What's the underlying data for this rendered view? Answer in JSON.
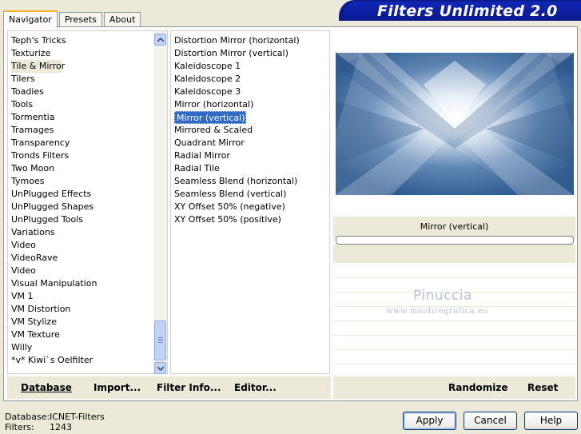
{
  "tabs": [
    "Navigator",
    "Presets",
    "About"
  ],
  "banner_title": "Filters Unlimited 2.0",
  "categories": [
    "Teph's Tricks",
    "Texturize",
    "Tile & Mirror",
    "Tilers",
    "Toadies",
    "Tools",
    "Tormentia",
    "Tramages",
    "Transparency",
    "Tronds Filters",
    "Two Moon",
    "Tymoes",
    "UnPlugged Effects",
    "UnPlugged Shapes",
    "UnPlugged Tools",
    "Variations",
    "Video",
    "VideoRave",
    "Video",
    "Visual Manipulation",
    "VM 1",
    "VM Distortion",
    "VM Stylize",
    "VM Texture",
    "Willy",
    "*v* Kiwi`s Oelfilter"
  ],
  "selected_category": "Tile & Mirror",
  "filters": [
    "Distortion Mirror (horizontal)",
    "Distortion Mirror (vertical)",
    "Kaleidoscope 1",
    "Kaleidoscope 2",
    "Kaleidoscope 3",
    "Mirror (horizontal)",
    "Mirror (vertical)",
    "Mirrored & Scaled",
    "Quadrant Mirror",
    "Radial Mirror",
    "Radial Tile",
    "Seamless Blend (horizontal)",
    "Seamless Blend (vertical)",
    "XY Offset 50% (negative)",
    "XY Offset 50% (positive)"
  ],
  "selected_filter": "Mirror (vertical)",
  "preview_filter_name": "Mirror (vertical)",
  "watermark": {
    "line1": "Pinuccia",
    "line2": "www.maidiregrafica.eu"
  },
  "toolbar_left": {
    "database": "Database",
    "import": "Import...",
    "filter_info": "Filter Info...",
    "editor": "Editor..."
  },
  "toolbar_right": {
    "randomize": "Randomize",
    "reset": "Reset"
  },
  "status": {
    "database_label": "Database:",
    "database_value": "ICNET-Filters",
    "filters_label": "Filters:",
    "filters_value": "1243"
  },
  "buttons": {
    "apply": "Apply",
    "cancel": "Cancel",
    "help": "Help"
  },
  "colors": {
    "selection": "#316ac5",
    "banner": "#0a1b8a",
    "face": "#ece9d8"
  }
}
